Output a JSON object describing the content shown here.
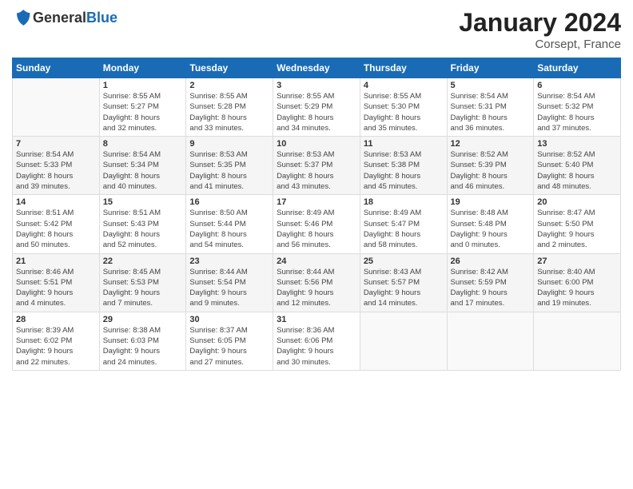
{
  "header": {
    "logo_general": "General",
    "logo_blue": "Blue",
    "month": "January 2024",
    "location": "Corsept, France"
  },
  "days_of_week": [
    "Sunday",
    "Monday",
    "Tuesday",
    "Wednesday",
    "Thursday",
    "Friday",
    "Saturday"
  ],
  "weeks": [
    [
      {
        "day": "",
        "info": ""
      },
      {
        "day": "1",
        "info": "Sunrise: 8:55 AM\nSunset: 5:27 PM\nDaylight: 8 hours\nand 32 minutes."
      },
      {
        "day": "2",
        "info": "Sunrise: 8:55 AM\nSunset: 5:28 PM\nDaylight: 8 hours\nand 33 minutes."
      },
      {
        "day": "3",
        "info": "Sunrise: 8:55 AM\nSunset: 5:29 PM\nDaylight: 8 hours\nand 34 minutes."
      },
      {
        "day": "4",
        "info": "Sunrise: 8:55 AM\nSunset: 5:30 PM\nDaylight: 8 hours\nand 35 minutes."
      },
      {
        "day": "5",
        "info": "Sunrise: 8:54 AM\nSunset: 5:31 PM\nDaylight: 8 hours\nand 36 minutes."
      },
      {
        "day": "6",
        "info": "Sunrise: 8:54 AM\nSunset: 5:32 PM\nDaylight: 8 hours\nand 37 minutes."
      }
    ],
    [
      {
        "day": "7",
        "info": "Sunrise: 8:54 AM\nSunset: 5:33 PM\nDaylight: 8 hours\nand 39 minutes."
      },
      {
        "day": "8",
        "info": "Sunrise: 8:54 AM\nSunset: 5:34 PM\nDaylight: 8 hours\nand 40 minutes."
      },
      {
        "day": "9",
        "info": "Sunrise: 8:53 AM\nSunset: 5:35 PM\nDaylight: 8 hours\nand 41 minutes."
      },
      {
        "day": "10",
        "info": "Sunrise: 8:53 AM\nSunset: 5:37 PM\nDaylight: 8 hours\nand 43 minutes."
      },
      {
        "day": "11",
        "info": "Sunrise: 8:53 AM\nSunset: 5:38 PM\nDaylight: 8 hours\nand 45 minutes."
      },
      {
        "day": "12",
        "info": "Sunrise: 8:52 AM\nSunset: 5:39 PM\nDaylight: 8 hours\nand 46 minutes."
      },
      {
        "day": "13",
        "info": "Sunrise: 8:52 AM\nSunset: 5:40 PM\nDaylight: 8 hours\nand 48 minutes."
      }
    ],
    [
      {
        "day": "14",
        "info": "Sunrise: 8:51 AM\nSunset: 5:42 PM\nDaylight: 8 hours\nand 50 minutes."
      },
      {
        "day": "15",
        "info": "Sunrise: 8:51 AM\nSunset: 5:43 PM\nDaylight: 8 hours\nand 52 minutes."
      },
      {
        "day": "16",
        "info": "Sunrise: 8:50 AM\nSunset: 5:44 PM\nDaylight: 8 hours\nand 54 minutes."
      },
      {
        "day": "17",
        "info": "Sunrise: 8:49 AM\nSunset: 5:46 PM\nDaylight: 8 hours\nand 56 minutes."
      },
      {
        "day": "18",
        "info": "Sunrise: 8:49 AM\nSunset: 5:47 PM\nDaylight: 8 hours\nand 58 minutes."
      },
      {
        "day": "19",
        "info": "Sunrise: 8:48 AM\nSunset: 5:48 PM\nDaylight: 9 hours\nand 0 minutes."
      },
      {
        "day": "20",
        "info": "Sunrise: 8:47 AM\nSunset: 5:50 PM\nDaylight: 9 hours\nand 2 minutes."
      }
    ],
    [
      {
        "day": "21",
        "info": "Sunrise: 8:46 AM\nSunset: 5:51 PM\nDaylight: 9 hours\nand 4 minutes."
      },
      {
        "day": "22",
        "info": "Sunrise: 8:45 AM\nSunset: 5:53 PM\nDaylight: 9 hours\nand 7 minutes."
      },
      {
        "day": "23",
        "info": "Sunrise: 8:44 AM\nSunset: 5:54 PM\nDaylight: 9 hours\nand 9 minutes."
      },
      {
        "day": "24",
        "info": "Sunrise: 8:44 AM\nSunset: 5:56 PM\nDaylight: 9 hours\nand 12 minutes."
      },
      {
        "day": "25",
        "info": "Sunrise: 8:43 AM\nSunset: 5:57 PM\nDaylight: 9 hours\nand 14 minutes."
      },
      {
        "day": "26",
        "info": "Sunrise: 8:42 AM\nSunset: 5:59 PM\nDaylight: 9 hours\nand 17 minutes."
      },
      {
        "day": "27",
        "info": "Sunrise: 8:40 AM\nSunset: 6:00 PM\nDaylight: 9 hours\nand 19 minutes."
      }
    ],
    [
      {
        "day": "28",
        "info": "Sunrise: 8:39 AM\nSunset: 6:02 PM\nDaylight: 9 hours\nand 22 minutes."
      },
      {
        "day": "29",
        "info": "Sunrise: 8:38 AM\nSunset: 6:03 PM\nDaylight: 9 hours\nand 24 minutes."
      },
      {
        "day": "30",
        "info": "Sunrise: 8:37 AM\nSunset: 6:05 PM\nDaylight: 9 hours\nand 27 minutes."
      },
      {
        "day": "31",
        "info": "Sunrise: 8:36 AM\nSunset: 6:06 PM\nDaylight: 9 hours\nand 30 minutes."
      },
      {
        "day": "",
        "info": ""
      },
      {
        "day": "",
        "info": ""
      },
      {
        "day": "",
        "info": ""
      }
    ]
  ]
}
